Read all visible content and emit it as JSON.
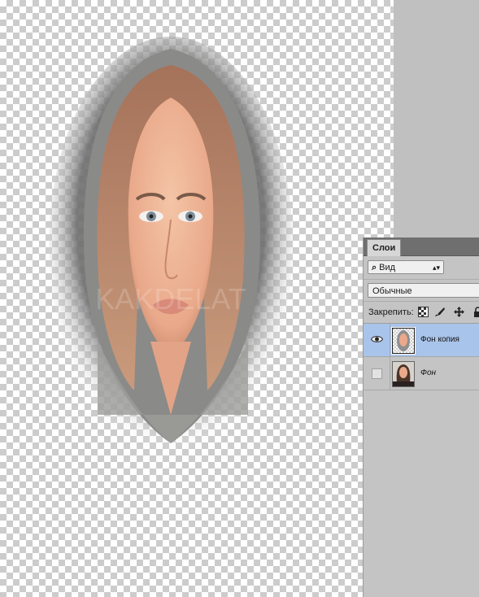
{
  "canvas": {
    "watermark": "KAKDELAT"
  },
  "layers_panel": {
    "tab_label": "Слои",
    "filter": {
      "icon": "search-icon",
      "label": "Вид"
    },
    "blend_mode": "Обычные",
    "lock_label": "Закрепить:",
    "layers": [
      {
        "name": "Фон копия",
        "visible": true,
        "selected": true,
        "italic": false
      },
      {
        "name": "Фон",
        "visible": false,
        "selected": false,
        "italic": true
      }
    ]
  },
  "colors": {
    "selection": "#a9c4ea",
    "panel_bg": "#c4c4c4",
    "tab_bar": "#6f6f6f",
    "pasteboard": "#c0c0c0"
  }
}
